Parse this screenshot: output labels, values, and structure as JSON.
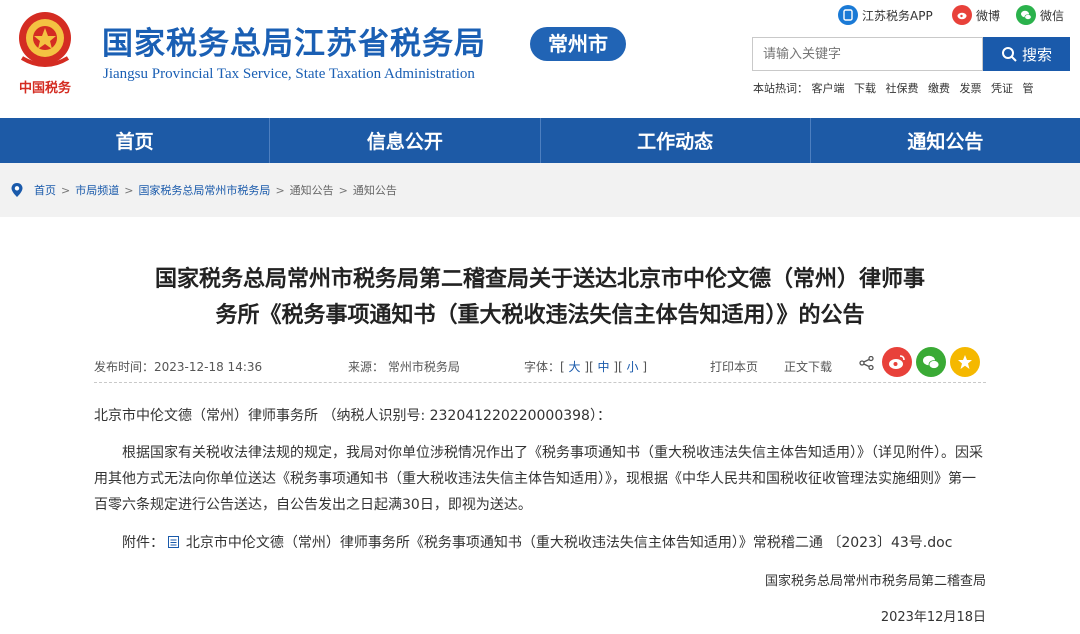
{
  "header": {
    "title_cn": "国家税务总局江苏省税务局",
    "title_en": "Jiangsu Provincial Tax Service, State Taxation Administration",
    "city_badge": "常州市",
    "emblem_text": "中国税务",
    "social": [
      {
        "label": "江苏税务APP",
        "icon": "app-icon",
        "color": "#1a7ad6"
      },
      {
        "label": "微博",
        "icon": "weibo-icon",
        "color": "#e8413a"
      },
      {
        "label": "微信",
        "icon": "wechat-icon",
        "color": "#2bb24c"
      }
    ]
  },
  "search": {
    "placeholder": "请输入关键字",
    "button": "搜索",
    "hot_label": "本站热词：",
    "hot_words": [
      "客户端",
      "下载",
      "社保费",
      "缴费",
      "发票",
      "凭证",
      "管"
    ]
  },
  "nav": {
    "items": [
      "首页",
      "信息公开",
      "工作动态",
      "通知公告"
    ]
  },
  "breadcrumb": {
    "items": [
      "首页",
      "市局频道",
      "国家税务总局常州市税务局",
      "通知公告",
      "通知公告"
    ]
  },
  "article": {
    "title_line1": "国家税务总局常州市税务局第二稽查局关于送达北京市中伦文德（常州）律师事",
    "title_line2": "务所《税务事项通知书（重大税收违法失信主体告知适用）》的公告",
    "publish_time": "发布时间：2023-12-18 14:36",
    "source": "来源： 常州市税务局",
    "font_label": "字体：",
    "font_large": "大",
    "font_mid": "中",
    "font_small": "小",
    "print": "打印本页",
    "download": "正文下载",
    "addressee": "北京市中伦文德（常州）律师事务所 （纳税人识别号: 232041220220000398）：",
    "body": "根据国家有关税收法律法规的规定，我局对你单位涉税情况作出了《税务事项通知书（重大税收违法失信主体告知适用）》（详见附件）。因采用其他方式无法向你单位送达《税务事项通知书（重大税收违法失信主体告知适用）》，现根据《中华人民共和国税收征收管理法实施细则》第一百零六条规定进行公告送达，自公告发出之日起满30日，即视为送达。",
    "attach_label": "附件：",
    "attach_file": "北京市中伦文德（常州）律师事务所《税务事项通知书（重大税收违法失信主体告知适用）》常税稽二通 〔2023〕43号.doc",
    "signature": "国家税务总局常州市税务局第二稽查局",
    "date": "2023年12月18日"
  },
  "colors": {
    "brand_blue": "#1d5aa6",
    "title_blue": "#1a5fb4",
    "share_weibo": "#e8413a",
    "share_wechat": "#3aaa35",
    "share_fav": "#f5b800"
  }
}
